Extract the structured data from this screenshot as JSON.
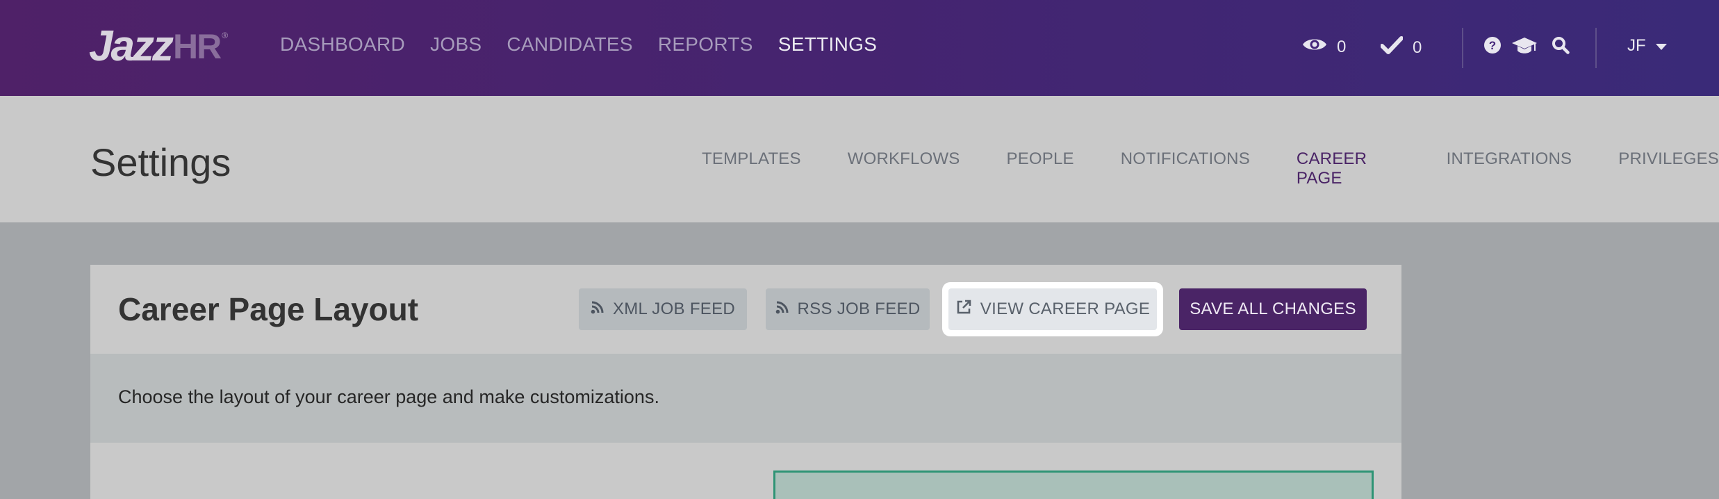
{
  "brand": {
    "jazz": "Jazz",
    "hr": "HR",
    "tm": "®"
  },
  "main_nav": [
    {
      "label": "DASHBOARD"
    },
    {
      "label": "JOBS"
    },
    {
      "label": "CANDIDATES"
    },
    {
      "label": "REPORTS"
    },
    {
      "label": "SETTINGS",
      "active": true
    }
  ],
  "top_right": {
    "views_count": "0",
    "checks_count": "0",
    "user_initials": "JF",
    "icons": [
      "eye-icon",
      "check-icon",
      "help-icon",
      "graduation-cap-icon",
      "search-icon",
      "caret-down-icon"
    ]
  },
  "settings": {
    "title": "Settings",
    "tabs": [
      {
        "label": "TEMPLATES"
      },
      {
        "label": "WORKFLOWS"
      },
      {
        "label": "PEOPLE"
      },
      {
        "label": "NOTIFICATIONS"
      },
      {
        "label": "CAREER PAGE",
        "active": true
      },
      {
        "label": "INTEGRATIONS"
      },
      {
        "label": "PRIVILEGES"
      }
    ]
  },
  "card": {
    "title": "Career Page Layout",
    "description": "Choose the layout of your career page and make customizations.",
    "buttons": {
      "xml_feed": "XML JOB FEED",
      "rss_feed": "RSS JOB FEED",
      "view_career_page": "VIEW CAREER PAGE",
      "save_all": "SAVE ALL CHANGES"
    }
  },
  "colors": {
    "topbar_start": "#4f2168",
    "topbar_end": "#3a2a78",
    "accent": "#4a2466",
    "preview_border": "#2e9475"
  }
}
